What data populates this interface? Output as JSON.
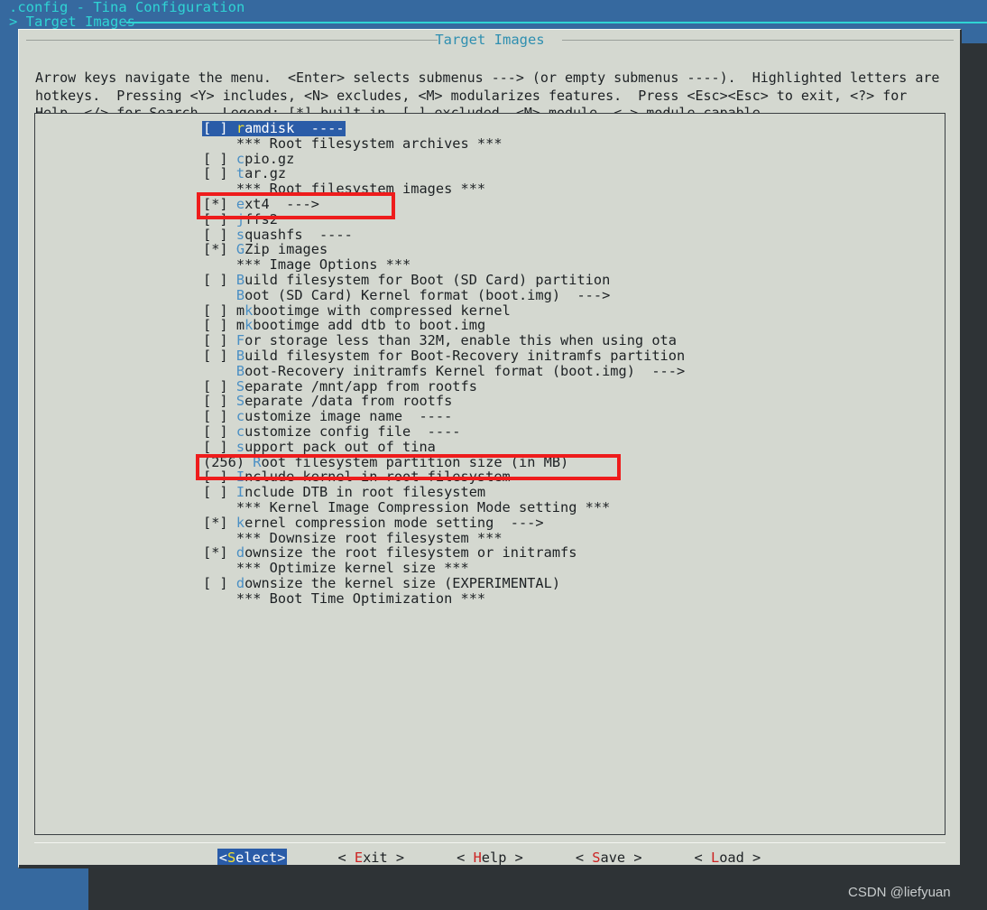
{
  "header": {
    "title": ".config - Tina Configuration",
    "breadcrumb": "> Target Images"
  },
  "dialog": {
    "title": "Target Images",
    "help_text": "Arrow keys navigate the menu.  <Enter> selects submenus ---> (or empty submenus ----).  Highlighted letters are hotkeys.  Pressing <Y> includes, <N> excludes, <M> modularizes features.  Press <Esc><Esc> to exit, <?> for Help, </> for Search.  Legend: [*] built-in  [ ] excluded  <M> module  < > module capable"
  },
  "menu": {
    "rows": [
      {
        "kind": "option",
        "prefix": "[ ]",
        "hotkey": "r",
        "rest": "amdisk  ----",
        "selected": true
      },
      {
        "kind": "separator",
        "text": "    *** Root filesystem archives ***"
      },
      {
        "kind": "option",
        "prefix": "[ ]",
        "hotkey": "c",
        "rest": "pio.gz"
      },
      {
        "kind": "option",
        "prefix": "[ ]",
        "hotkey": "t",
        "rest": "ar.gz"
      },
      {
        "kind": "separator",
        "text": "    *** Root filesystem images ***"
      },
      {
        "kind": "option",
        "prefix": "[*]",
        "hotkey": "e",
        "rest": "xt4  --->"
      },
      {
        "kind": "option",
        "prefix": "[ ]",
        "hotkey": "j",
        "rest": "ffs2"
      },
      {
        "kind": "option",
        "prefix": "[ ]",
        "hotkey": "s",
        "rest": "quashfs  ----"
      },
      {
        "kind": "option",
        "prefix": "[*]",
        "hotkey": "G",
        "rest": "Zip images"
      },
      {
        "kind": "separator",
        "text": "    *** Image Options ***"
      },
      {
        "kind": "option",
        "prefix": "[ ]",
        "hotkey": "B",
        "rest": "uild filesystem for Boot (SD Card) partition"
      },
      {
        "kind": "submenu",
        "prefix": "   ",
        "hotkey": "B",
        "rest": "oot (SD Card) Kernel format (boot.img)  --->"
      },
      {
        "kind": "option",
        "prefix": "[ ]",
        "hotkey": "mk",
        "rest": "bootimge with compressed kernel",
        "hk_len": 2,
        "pre_hk": "m"
      },
      {
        "kind": "option",
        "prefix": "[ ]",
        "hotkey": "k",
        "rest": "bootimge add dtb to boot.img",
        "pre_hk": "m"
      },
      {
        "kind": "option",
        "prefix": "[ ]",
        "hotkey": "F",
        "rest": "or storage less than 32M, enable this when using ota"
      },
      {
        "kind": "option",
        "prefix": "[ ]",
        "hotkey": "B",
        "rest": "uild filesystem for Boot-Recovery initramfs partition"
      },
      {
        "kind": "submenu",
        "prefix": "   ",
        "hotkey": "B",
        "rest": "oot-Recovery initramfs Kernel format (boot.img)  --->"
      },
      {
        "kind": "option",
        "prefix": "[ ]",
        "hotkey": "S",
        "rest": "eparate /mnt/app from rootfs"
      },
      {
        "kind": "option",
        "prefix": "[ ]",
        "hotkey": "S",
        "rest": "eparate /data from rootfs"
      },
      {
        "kind": "option",
        "prefix": "[ ]",
        "hotkey": "c",
        "rest": "ustomize image name  ----"
      },
      {
        "kind": "option",
        "prefix": "[ ]",
        "hotkey": "c",
        "rest": "ustomize config file  ----"
      },
      {
        "kind": "option",
        "prefix": "[ ]",
        "hotkey": "s",
        "rest": "upport pack out of tina"
      },
      {
        "kind": "value",
        "prefix": "(256)",
        "hotkey": "R",
        "rest": "oot filesystem partition size (in MB)"
      },
      {
        "kind": "option",
        "prefix": "[ ]",
        "hotkey": "I",
        "rest": "nclude kernel in root filesystem  ----"
      },
      {
        "kind": "option",
        "prefix": "[ ]",
        "hotkey": "I",
        "rest": "nclude DTB in root filesystem"
      },
      {
        "kind": "separator",
        "text": "    *** Kernel Image Compression Mode setting ***"
      },
      {
        "kind": "option",
        "prefix": "[*]",
        "hotkey": "k",
        "rest": "ernel compression mode setting  --->"
      },
      {
        "kind": "separator",
        "text": "    *** Downsize root filesystem ***"
      },
      {
        "kind": "option",
        "prefix": "[*]",
        "hotkey": "d",
        "rest": "ownsize the root filesystem or initramfs"
      },
      {
        "kind": "separator",
        "text": "    *** Optimize kernel size ***"
      },
      {
        "kind": "option",
        "prefix": "[ ]",
        "hotkey": "d",
        "rest": "ownsize the kernel size (EXPERIMENTAL)"
      },
      {
        "kind": "separator",
        "text": "    *** Boot Time Optimization ***"
      }
    ]
  },
  "buttons": [
    {
      "label": "<Select>",
      "hotkey_index": 1,
      "active": true
    },
    {
      "label": "< Exit >",
      "hotkey_index": 2,
      "active": false
    },
    {
      "label": "< Help >",
      "hotkey_index": 2,
      "active": false
    },
    {
      "label": "< Save >",
      "hotkey_index": 2,
      "active": false
    },
    {
      "label": "< Load >",
      "hotkey_index": 2,
      "active": false
    }
  ],
  "annotations": {
    "box1_target": "ext4  --->",
    "box2_target": "(256) Root filesystem partition size (in MB)",
    "color": "#ee1c1c"
  },
  "watermark": "CSDN @liefyuan",
  "colors": {
    "terminal_blue": "#36699f",
    "header_cyan": "#2fd4d4",
    "dialog_bg": "#d4d8d0",
    "hotkey_blue": "#4a8fc4",
    "selected_bg": "#2a5ca8",
    "selected_hotkey": "#f4e12c",
    "button_hotkey_red": "#cc2222",
    "annotation_red": "#ee1c1c"
  }
}
